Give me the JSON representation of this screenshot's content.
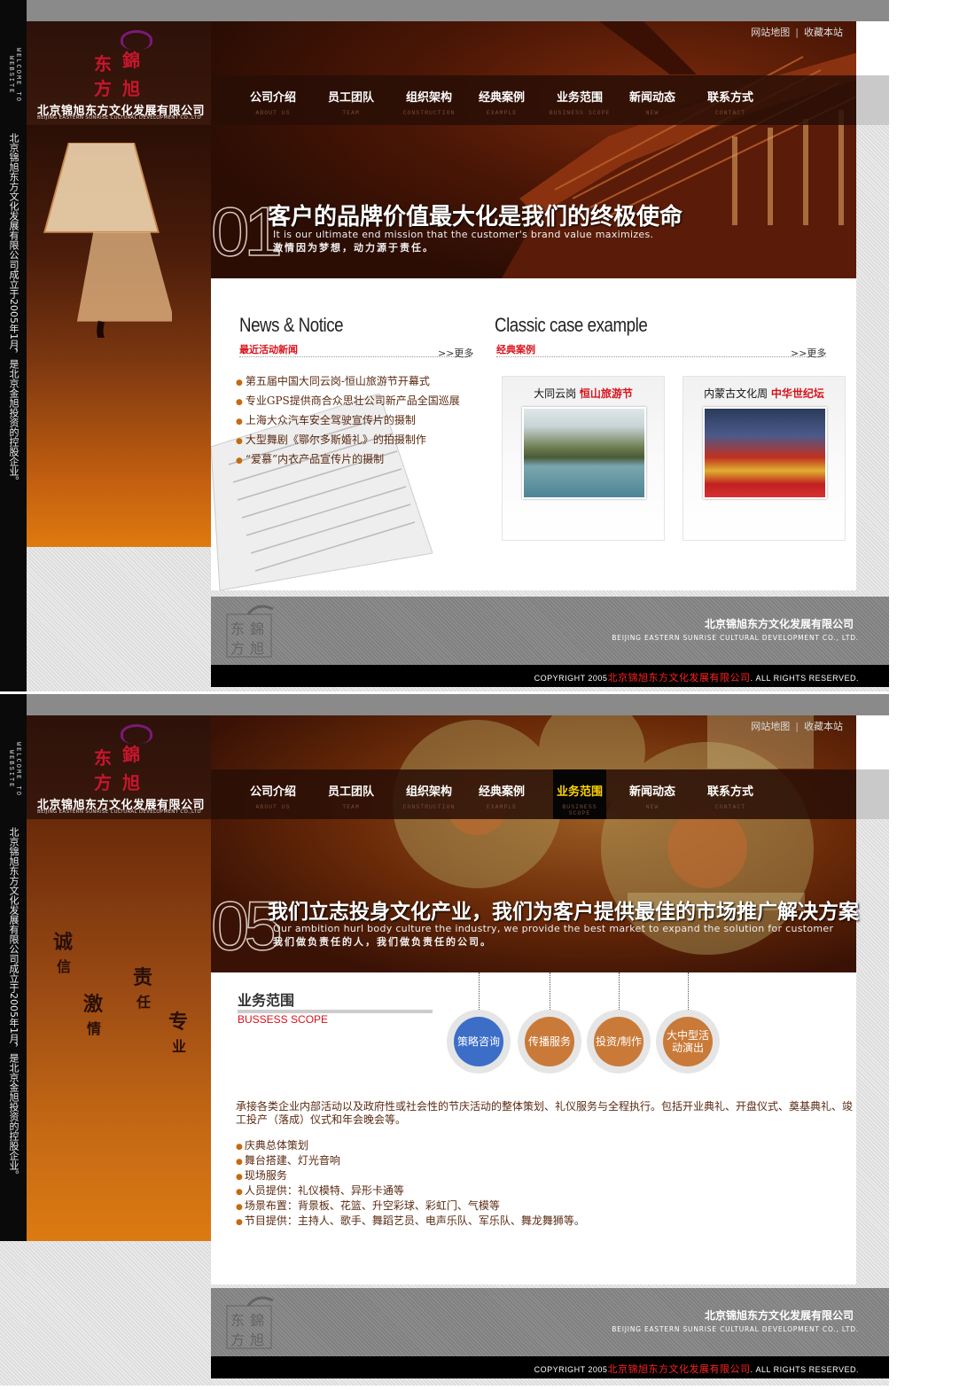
{
  "common": {
    "welcome_vertical": "WELCOME TO WEBSITE",
    "left_vertical_text": "北京锦旭东方文化发展有限公司成立于2005年1月，是北京金旭投资的控股企业。",
    "logo_seal_chars": [
      "东",
      "錦",
      "方",
      "旭"
    ],
    "company_cn": "北京锦旭东方文化发展有限公司",
    "company_en": "BEIJING EASTERN SUNRISE CULTURAL DEVELOPMENT CO.,LTD",
    "top_links": [
      "网站地图",
      "收藏本站"
    ],
    "nav": [
      {
        "cn": "公司介绍",
        "en": "ABOUT US"
      },
      {
        "cn": "员工团队",
        "en": "TEAM"
      },
      {
        "cn": "组织架构",
        "en": "CONSTRUCTION"
      },
      {
        "cn": "经典案例",
        "en": "EXAMPLE"
      },
      {
        "cn": "业务范围",
        "en": "BUSINESS SCOPE"
      },
      {
        "cn": "新闻动态",
        "en": "NEW"
      },
      {
        "cn": "联系方式",
        "en": "CONTACT"
      }
    ],
    "footer": {
      "company_cn": "北京锦旭东方文化发展有限公司",
      "company_en": "BEIJING EASTERN SUNRISE CULTURAL DEVELOPMENT CO., LTD.",
      "copyright_prefix": "COPYRIGHT   2005",
      "copyright_company": "北京锦旭东方文化发展有限公司",
      "copyright_suffix": ".   ALL RIGHTS RESERVED."
    }
  },
  "page1": {
    "banner_num": "01",
    "slogan_cn": "客户的品牌价值最大化是我们的终极使命",
    "slogan_en": "It is our ultimate end mission that the customer's brand value maximizes.",
    "slogan_sub": "激情因为梦想，动力源于责任。",
    "news_title": "News & Notice",
    "news_sub": "最近活动新闻",
    "news_more": ">>更多",
    "news_items": [
      "第五届中国大同云岗-恒山旅游节开幕式",
      "专业GPS提供商合众思壮公司新产品全国巡展",
      "上海大众汽车安全驾驶宣传片的摄制",
      "大型舞剧《鄂尔多斯婚礼》的拍摄制作",
      "“爱慕”内衣产品宣传片的摄制"
    ],
    "case_title": "Classic case example",
    "case_sub": "经典案例",
    "case_more": ">>更多",
    "cases": [
      {
        "plain": "大同云岗",
        "highlight": "恒山旅游节"
      },
      {
        "plain": "内蒙古文化周",
        "highlight": "中华世纪坛"
      }
    ],
    "active_nav": ""
  },
  "page2": {
    "banner_num": "05",
    "slogan_cn": "我们立志投身文化产业，我们为客户提供最佳的市场推广解决方案",
    "slogan_en": "Our   ambition hurl body culture the industry, we provide the best market to expand the solution for customer",
    "slogan_sub": "我们做负责任的人，我们做负责任的公司。",
    "active_nav": "业务范围",
    "values": [
      {
        "a": "诚",
        "b": "信"
      },
      {
        "a": "责",
        "b": "任"
      },
      {
        "a": "激",
        "b": "情"
      },
      {
        "a": "专",
        "b": "业"
      }
    ],
    "scope_title": "业务范围",
    "scope_en": "BUSSESS SCOPE",
    "circles": [
      "策略咨询",
      "传播服务",
      "投资/制作",
      "大中型活动演出"
    ],
    "description": "承接各类企业内部活动以及政府性或社会性的节庆活动的整体策划、礼仪服务与全程执行。包括开业典礼、开盘仪式、奠基典礼、竣工投产（落成）仪式和年会晚会等。",
    "items": [
      "庆典总体策划",
      "舞台搭建、灯光音响",
      "现场服务",
      "人员提供：礼仪模特、异形卡通等",
      "场景布置：背景板、花篮、升空彩球、彩虹门、气模等",
      "节目提供：主持人、歌手、舞蹈艺员、电声乐队、军乐队、舞龙舞狮等。"
    ]
  },
  "colors": {
    "accent_red": "#d8121b",
    "nav_active": "#ffd200",
    "brown": "#5a2a12",
    "orange": "#de7a0e",
    "blue_circle": "#3c6ec8"
  }
}
